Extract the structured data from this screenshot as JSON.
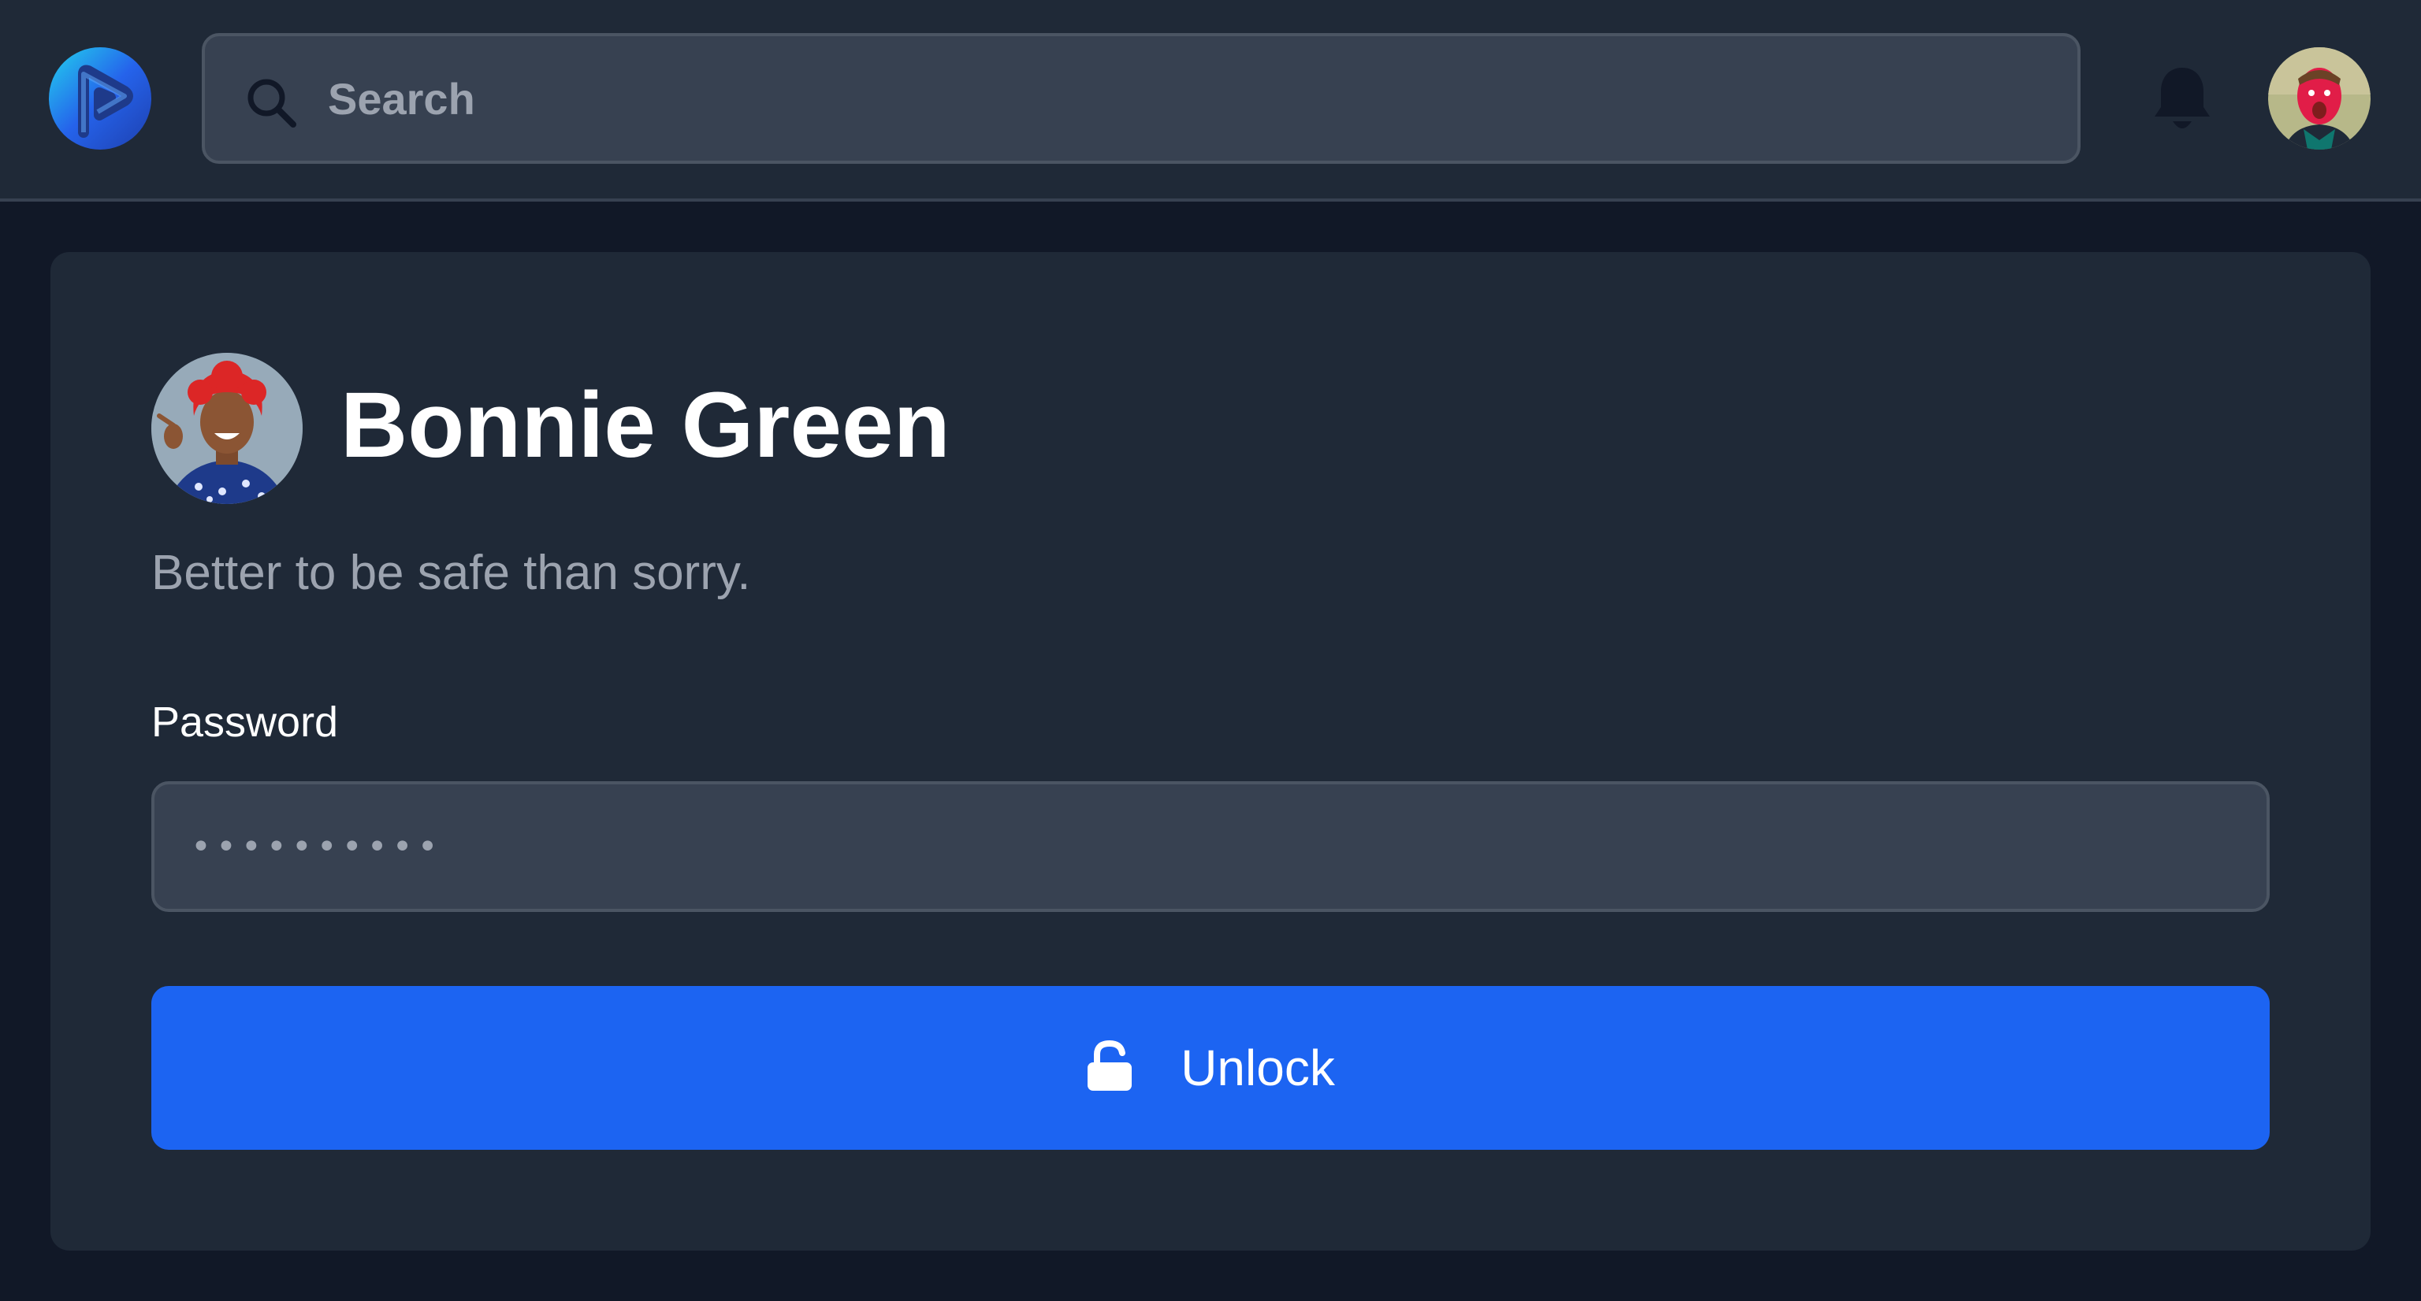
{
  "navbar": {
    "logo_icon": "brand-logo-icon",
    "search": {
      "placeholder": "Search",
      "icon": "search-icon"
    },
    "notifications_icon": "bell-icon",
    "user_avatar": "user-avatar"
  },
  "lock_screen": {
    "user_name": "Bonnie Green",
    "tagline": "Better to be safe than sorry.",
    "password_label": "Password",
    "password_value": "••••••••••",
    "unlock_button": {
      "label": "Unlock",
      "icon": "lock-open-icon"
    }
  },
  "colors": {
    "page_background": "#111827",
    "navbar_background": "#1f2937",
    "card_background": "#1f2937",
    "input_background": "#374151",
    "input_border": "#4b5563",
    "muted_text": "#9ca3af",
    "primary_button": "#1c64f2"
  }
}
